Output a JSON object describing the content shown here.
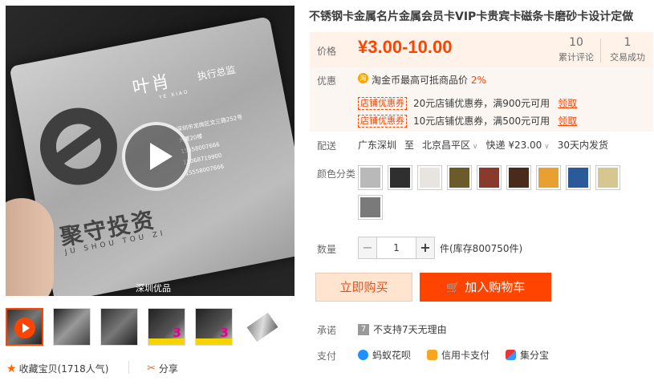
{
  "video": {
    "watermark": "深圳优品",
    "card": {
      "name": "叶肖",
      "name_en": "YE XIAO",
      "position": "执行总监",
      "address": "深圳市龙岗区文三路252号",
      "building": "大厦20楼",
      "phone1": "15558007666",
      "phone2": "15068719900",
      "phone3": "15558007666",
      "company": "聚守投资",
      "company_en": "JU SHOU TOU ZI"
    }
  },
  "actions": {
    "collect": "收藏宝贝",
    "popularity": "(1718人气)",
    "share": "分享"
  },
  "product": {
    "title": "不锈钢卡金属名片金属会员卡VIP卡贵宾卡磁条卡磨砂卡设计定做",
    "price_label": "价格",
    "price": "¥3.00-10.00",
    "reviews_count": "10",
    "reviews_label": "累计评论",
    "sales_count": "1",
    "sales_label": "交易成功"
  },
  "promo": {
    "label": "优惠",
    "coin_icon": "淘",
    "taobao_coin": "淘金币最高可抵商品价",
    "taobao_pct": "2%",
    "coupons": [
      {
        "tag": "店铺优惠券",
        "desc": "20元店铺优惠券，满900元可用",
        "action": "领取"
      },
      {
        "tag": "店铺优惠券",
        "desc": "10元店铺优惠券，满500元可用",
        "action": "领取"
      }
    ]
  },
  "shipping": {
    "label": "配送",
    "from": "广东深圳",
    "to_prefix": "至",
    "to": "北京昌平区",
    "method": "快递 ¥23.00",
    "time": "30天内发货"
  },
  "colors": {
    "label": "颜色分类",
    "swatches": [
      "#b9b9b9",
      "#2f2f2f",
      "#e8e4e0",
      "#6b5a2a",
      "#8a3a2a",
      "#4a2a1a",
      "#e8a030",
      "#2a5a9a",
      "#d8c690",
      "#7a7a7a"
    ]
  },
  "quantity": {
    "label": "数量",
    "minus": "−",
    "value": "1",
    "plus": "+",
    "stock": "件(库存800750件)"
  },
  "buttons": {
    "buy_now": "立即购买",
    "add_to_cart": "加入购物车",
    "cart_icon": "🛒"
  },
  "service": {
    "promise_label": "承诺",
    "promise_icon": "7",
    "promise_text": "不支持7天无理由",
    "pay_label": "支付",
    "methods": [
      "蚂蚁花呗",
      "信用卡支付",
      "集分宝"
    ]
  }
}
